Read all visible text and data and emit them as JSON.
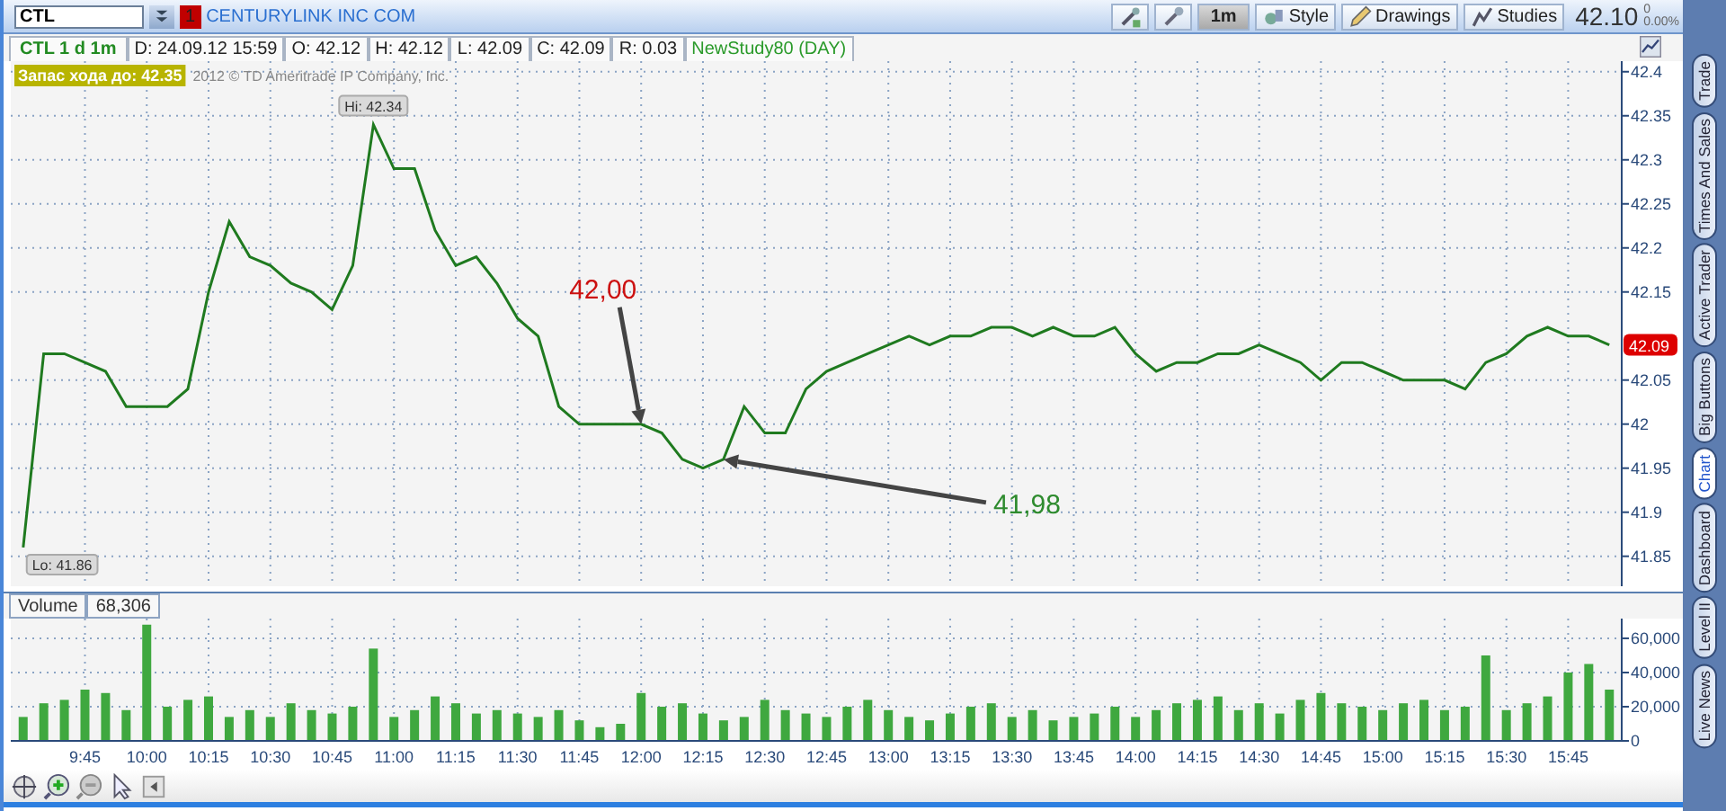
{
  "header": {
    "symbol": "CTL",
    "badge": "1",
    "company": "CENTURYLINK INC COM",
    "buttons": [
      {
        "kind": "tools"
      },
      {
        "kind": "link"
      },
      {
        "kind": "interval",
        "label": "1m"
      },
      {
        "kind": "style",
        "label": "Style"
      },
      {
        "kind": "drawings",
        "label": "Drawings"
      },
      {
        "kind": "studies",
        "label": "Studies"
      }
    ],
    "last_price": "42.10",
    "change": "0",
    "change_pct": "0.00%"
  },
  "info_bar": [
    {
      "kind": "title",
      "text": "CTL 1 d 1m"
    },
    {
      "kind": "plain",
      "text": "D: 24.09.12 15:59"
    },
    {
      "kind": "plain",
      "text": "O: 42.12"
    },
    {
      "kind": "plain",
      "text": "H: 42.12"
    },
    {
      "kind": "plain",
      "text": "L: 42.09"
    },
    {
      "kind": "plain",
      "text": "C: 42.09"
    },
    {
      "kind": "plain",
      "text": "R: 0.03"
    },
    {
      "kind": "study",
      "text": "NewStudy80 (DAY)"
    }
  ],
  "price_chart": {
    "range_label": "Запас хода до: 42.35",
    "copyright": "2012 © TD Ameritrade IP Company, Inc.",
    "high_label": "Hi: 42.34",
    "low_label": "Lo: 41.86",
    "last_price_tag": {
      "text": "42.09",
      "color": "#dd0000"
    },
    "chart_data": {
      "type": "line",
      "grid": true,
      "ylim": [
        41.816,
        42.412
      ],
      "categories": [
        null,
        null,
        null,
        null,
        null,
        null,
        null,
        null,
        null,
        null,
        null,
        null,
        null,
        null,
        null,
        null,
        null,
        null,
        null,
        null,
        null,
        null,
        null,
        null,
        null,
        null,
        null,
        null,
        null,
        null,
        null,
        null,
        null,
        null,
        null,
        null,
        null,
        null,
        null,
        null,
        null,
        null,
        null,
        null,
        null,
        null,
        null,
        null,
        null,
        null,
        null,
        null,
        null,
        null,
        null,
        null,
        null,
        null,
        null,
        null,
        null,
        null,
        null,
        null,
        null,
        null,
        null,
        null,
        null,
        null,
        null,
        null,
        null,
        null,
        null,
        null,
        null,
        null
      ],
      "series": [
        {
          "color": "#1f7a1f",
          "values": [
            41.86,
            42.08,
            42.08,
            42.07,
            42.06,
            42.02,
            42.02,
            42.02,
            42.04,
            42.15,
            42.23,
            42.19,
            42.18,
            42.16,
            42.15,
            42.13,
            42.18,
            42.34,
            42.29,
            42.29,
            42.22,
            42.18,
            42.19,
            42.16,
            42.12,
            42.1,
            42.02,
            42.0,
            42.0,
            42.0,
            42.0,
            41.99,
            41.96,
            41.95,
            41.96,
            42.02,
            41.99,
            41.99,
            42.04,
            42.06,
            42.07,
            42.08,
            42.09,
            42.1,
            42.09,
            42.1,
            42.1,
            42.11,
            42.11,
            42.1,
            42.11,
            42.1,
            42.1,
            42.11,
            42.08,
            42.06,
            42.07,
            42.07,
            42.08,
            42.08,
            42.09,
            42.08,
            42.07,
            42.05,
            42.07,
            42.07,
            42.06,
            42.05,
            42.05,
            42.05,
            42.04,
            42.07,
            42.08,
            42.1,
            42.11,
            42.1,
            42.1,
            42.09
          ]
        }
      ],
      "yticks": [
        {
          "value": 41.85,
          "label": "41.85"
        },
        {
          "value": 41.9,
          "label": "41.9"
        },
        {
          "value": 41.95,
          "label": "41.95"
        },
        {
          "value": 42,
          "label": "42"
        },
        {
          "value": 42.05,
          "label": "42.05"
        },
        {
          "value": 42.15,
          "label": "42.15"
        },
        {
          "value": 42.2,
          "label": "42.2"
        },
        {
          "value": 42.25,
          "label": "42.25"
        },
        {
          "value": 42.3,
          "label": "42.3"
        },
        {
          "value": 42.35,
          "label": "42.35"
        },
        {
          "value": 42.4,
          "label": "42.4"
        }
      ],
      "annotations": [
        "42,00",
        "41,98"
      ]
    }
  },
  "volume_chart": {
    "title": "Volume",
    "reading": "68,306",
    "chart_data": {
      "type": "bar",
      "grid": true,
      "ylim": [
        0,
        68400
      ],
      "categories": [
        null,
        null,
        null,
        "9:45",
        null,
        null,
        "10:00",
        null,
        null,
        "10:15",
        null,
        null,
        "10:30",
        null,
        null,
        "10:45",
        null,
        null,
        "11:00",
        null,
        null,
        "11:15",
        null,
        null,
        "11:30",
        null,
        null,
        "11:45",
        null,
        null,
        "12:00",
        null,
        null,
        "12:15",
        null,
        null,
        "12:30",
        null,
        null,
        "12:45",
        null,
        null,
        "13:00",
        null,
        null,
        "13:15",
        null,
        null,
        "13:30",
        null,
        null,
        "13:45",
        null,
        null,
        "14:00",
        null,
        null,
        "14:15",
        null,
        null,
        "14:30",
        null,
        null,
        "14:45",
        null,
        null,
        "15:00",
        null,
        null,
        "15:15",
        null,
        null,
        "15:30",
        null,
        null,
        "15:45",
        null,
        null
      ],
      "series": [
        {
          "color": "#3fa83f",
          "values": [
            14000,
            22000,
            24000,
            30000,
            28000,
            18000,
            68000,
            20000,
            24000,
            26000,
            14000,
            18000,
            14000,
            22000,
            18000,
            16000,
            20000,
            54000,
            14000,
            18000,
            26000,
            22000,
            16000,
            18000,
            16000,
            14000,
            18000,
            12000,
            8000,
            10000,
            28000,
            20000,
            22000,
            16000,
            12000,
            14000,
            24000,
            18000,
            16000,
            14000,
            20000,
            24000,
            18000,
            14000,
            12000,
            16000,
            20000,
            22000,
            14000,
            18000,
            12000,
            14000,
            16000,
            20000,
            14000,
            18000,
            22000,
            24000,
            26000,
            18000,
            22000,
            16000,
            24000,
            28000,
            22000,
            20000,
            18000,
            22000,
            24000,
            18000,
            20000,
            50000,
            18000,
            22000,
            26000,
            40000,
            45000,
            30000
          ]
        }
      ],
      "yticks": [
        {
          "value": 0,
          "label": "0"
        },
        {
          "value": 20000,
          "label": "20,000"
        },
        {
          "value": 40000,
          "label": "40,000"
        },
        {
          "value": 60000,
          "label": "60,000"
        }
      ]
    }
  },
  "bottom_toolbar": [
    {
      "kind": "crosshair"
    },
    {
      "kind": "zoom-in"
    },
    {
      "kind": "zoom-out"
    },
    {
      "kind": "pointer"
    },
    {
      "kind": "scroll-left"
    }
  ],
  "side_tabs": [
    {
      "label": "Trade",
      "selected": false
    },
    {
      "label": "Times And Sales",
      "selected": false
    },
    {
      "label": "Active Trader",
      "selected": false
    },
    {
      "label": "Big Buttons",
      "selected": false
    },
    {
      "label": "Chart",
      "selected": true
    },
    {
      "label": "Dashboard",
      "selected": false
    },
    {
      "label": "Level II",
      "selected": false
    },
    {
      "label": "Live News",
      "selected": false
    }
  ]
}
